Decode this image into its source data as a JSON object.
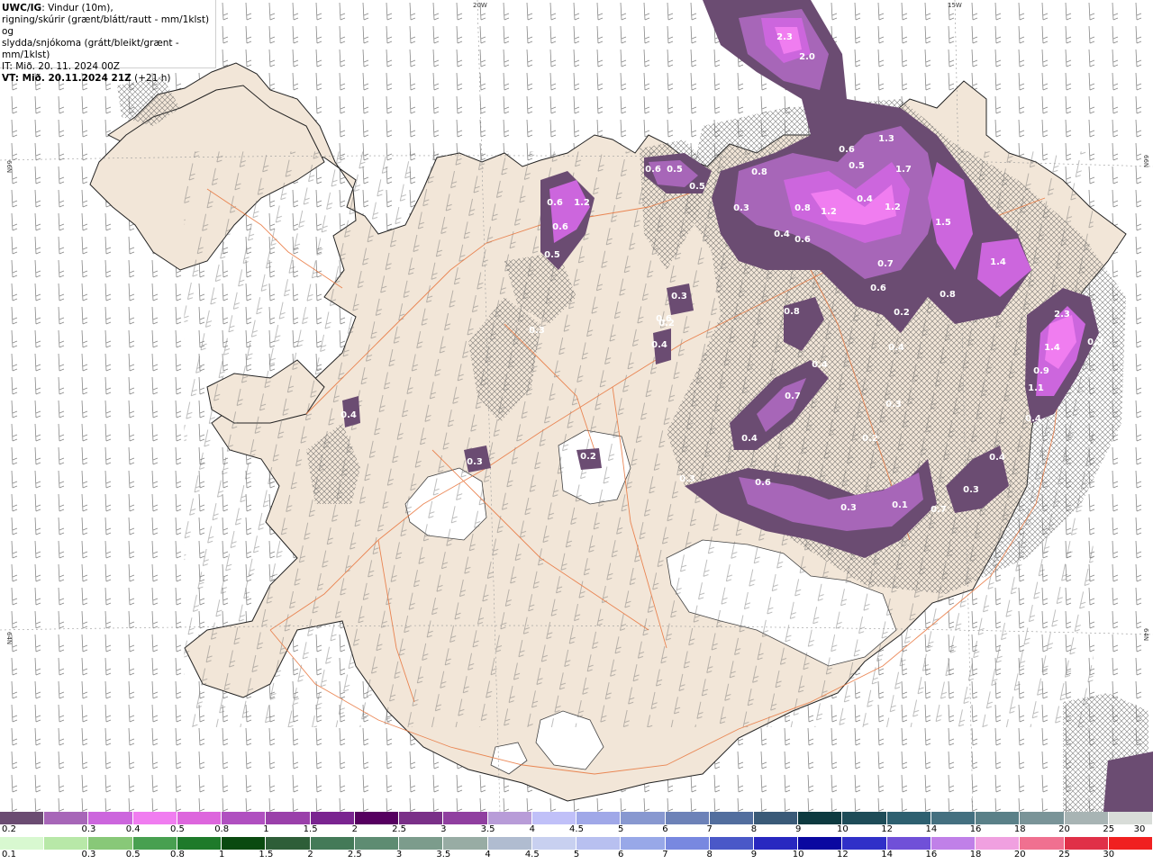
{
  "header": {
    "title_bold": "UWC/IG",
    "title_rest": ": Vindur (10m),",
    "line2": "rigning/skúrir (grænt/blátt/rautt - mm/1klst) og",
    "line3": "slydda/snjókoma (grátt/bleikt/grænt - mm/1klst)",
    "line4": "IT: Mið. 20. 11. 2024 00Z",
    "line5_bold": "VT: Mið. 20.11.2024 21Z",
    "line5_rest": " (+21 h)"
  },
  "graticule": {
    "lon_labels": [
      "20W",
      "15W"
    ],
    "lat_labels_left": [
      "66N",
      "64N"
    ],
    "lat_labels_right": [
      "66N",
      "64N"
    ]
  },
  "precip_labels": [
    "2.3",
    "2.0",
    "0.6",
    "0.5",
    "1.3",
    "1.7",
    "0.8",
    "0.6",
    "0.5",
    "0.5",
    "0.3",
    "0.8",
    "1.2",
    "0.4",
    "1.2",
    "1.5",
    "0.4",
    "0.6",
    "0.7",
    "1.4",
    "0.6",
    "0.8",
    "0.3",
    "0.6",
    "1.2",
    "0.6",
    "0.5",
    "0.3",
    "0.2",
    "0.4",
    "0.8",
    "0.6",
    "0.2",
    "0.4",
    "2.3",
    "1.4",
    "0.3",
    "0.9",
    "1.1",
    "0.4",
    "0.7",
    "0.3",
    "0.4",
    "0.3",
    "0.2",
    "0.4",
    "0.6",
    "0.3",
    "0.4",
    "0.1",
    "0.3",
    "0.2",
    "0.7",
    "0.3",
    "0.4"
  ],
  "legend_snow": {
    "labels": [
      "0.2",
      "0.3",
      "0.4",
      "0.5",
      "0.8",
      "1",
      "1.5",
      "2",
      "2.5",
      "3",
      "3.5",
      "4",
      "4.5",
      "5",
      "6",
      "7",
      "8",
      "9",
      "10",
      "12",
      "14",
      "16",
      "18",
      "20",
      "25",
      "30"
    ],
    "colors": [
      "#6b4c72",
      "#a766b8",
      "#cc66dd",
      "#f07df0",
      "#dd66dd",
      "#b050c0",
      "#9a40aa",
      "#7a2490",
      "#560060",
      "#7a3088",
      "#903fa0",
      "#b89cd8",
      "#c0c0f8",
      "#a0a8e8",
      "#8898d0",
      "#6d82b8",
      "#526e9e",
      "#3a5a78",
      "#0d3a40",
      "#1e4c58",
      "#2e6070",
      "#447080",
      "#5a8088",
      "#7a9498",
      "#a8b4b4",
      "#d8dcd8"
    ]
  },
  "legend_rain": {
    "labels": [
      "0.1",
      "0.3",
      "0.5",
      "0.8",
      "1",
      "1.5",
      "2",
      "2.5",
      "3",
      "3.5",
      "4",
      "4.5",
      "5",
      "6",
      "7",
      "8",
      "9",
      "10",
      "12",
      "14",
      "16",
      "18",
      "20",
      "25",
      "30"
    ],
    "colors": [
      "#d8f8d0",
      "#b8e8a8",
      "#88c878",
      "#48a050",
      "#1e7a2a",
      "#0a4a10",
      "#2e5e38",
      "#447a58",
      "#5e8c72",
      "#7c9c8c",
      "#98aca4",
      "#b0bcd0",
      "#c8d0f0",
      "#b8c0f0",
      "#98a8e8",
      "#7888e0",
      "#4a58c8",
      "#2828c0",
      "#0a08a0",
      "#3030c8",
      "#7050d8",
      "#c080e8",
      "#f0a0e0",
      "#f07090",
      "#e03048",
      "#f02020"
    ]
  }
}
